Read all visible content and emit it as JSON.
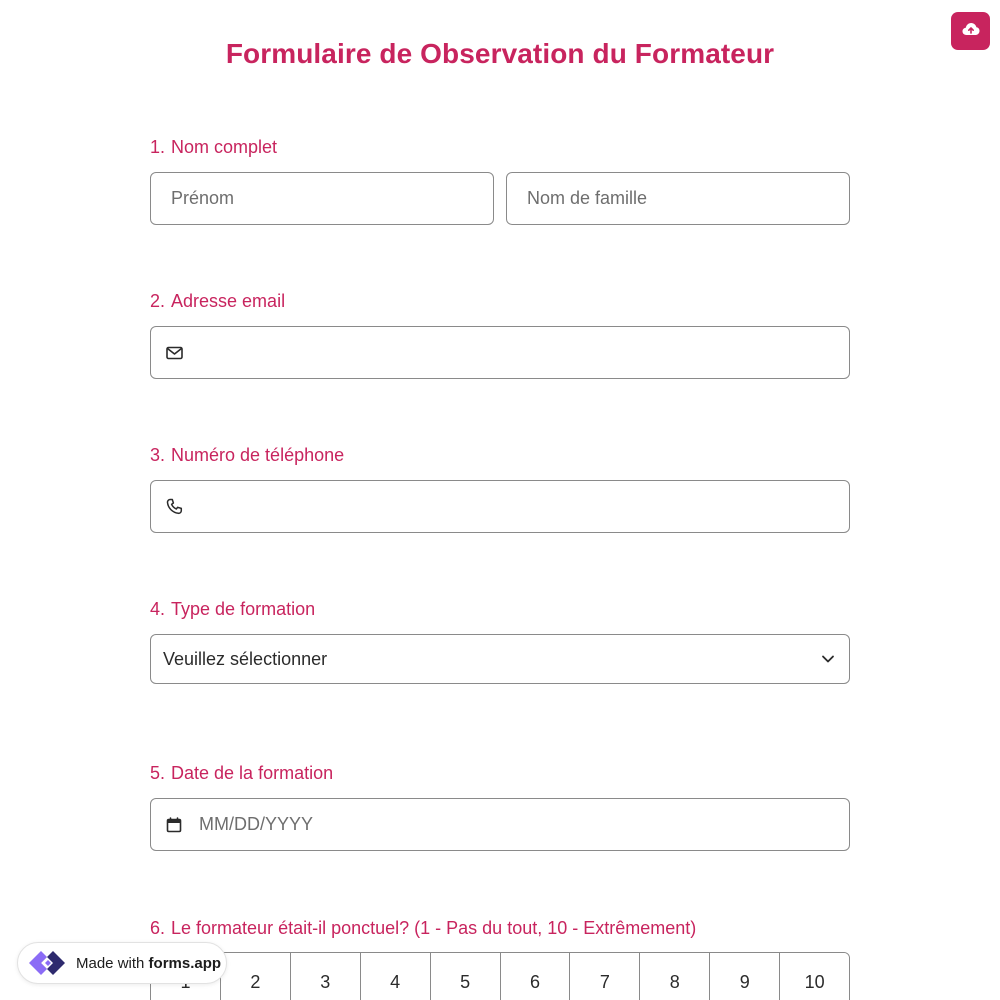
{
  "header": {
    "title": "Formulaire de Observation du Formateur",
    "upload_icon": "cloud-upload-icon"
  },
  "colors": {
    "accent": "#c8245e",
    "border": "#8a8a8a",
    "placeholder": "#6e6e6e"
  },
  "questions": [
    {
      "num": "1.",
      "label": "Nom complet"
    },
    {
      "num": "2.",
      "label": "Adresse email"
    },
    {
      "num": "3.",
      "label": "Numéro de téléphone"
    },
    {
      "num": "4.",
      "label": "Type de formation"
    },
    {
      "num": "5.",
      "label": "Date de la formation"
    },
    {
      "num": "6.",
      "label": "Le formateur était-il ponctuel? (1 - Pas du tout, 10 - Extrêmement)"
    }
  ],
  "fields": {
    "first_name_placeholder": "Prénom",
    "last_name_placeholder": "Nom de famille",
    "email_icon": "mail-icon",
    "phone_icon": "phone-icon",
    "select_value": "Veuillez sélectionner",
    "date_placeholder": "MM/DD/YYYY",
    "date_icon": "calendar-icon"
  },
  "scale": [
    "1",
    "2",
    "3",
    "4",
    "5",
    "6",
    "7",
    "8",
    "9",
    "10"
  ],
  "badge": {
    "prefix": "Made with",
    "brand": "forms.app"
  }
}
